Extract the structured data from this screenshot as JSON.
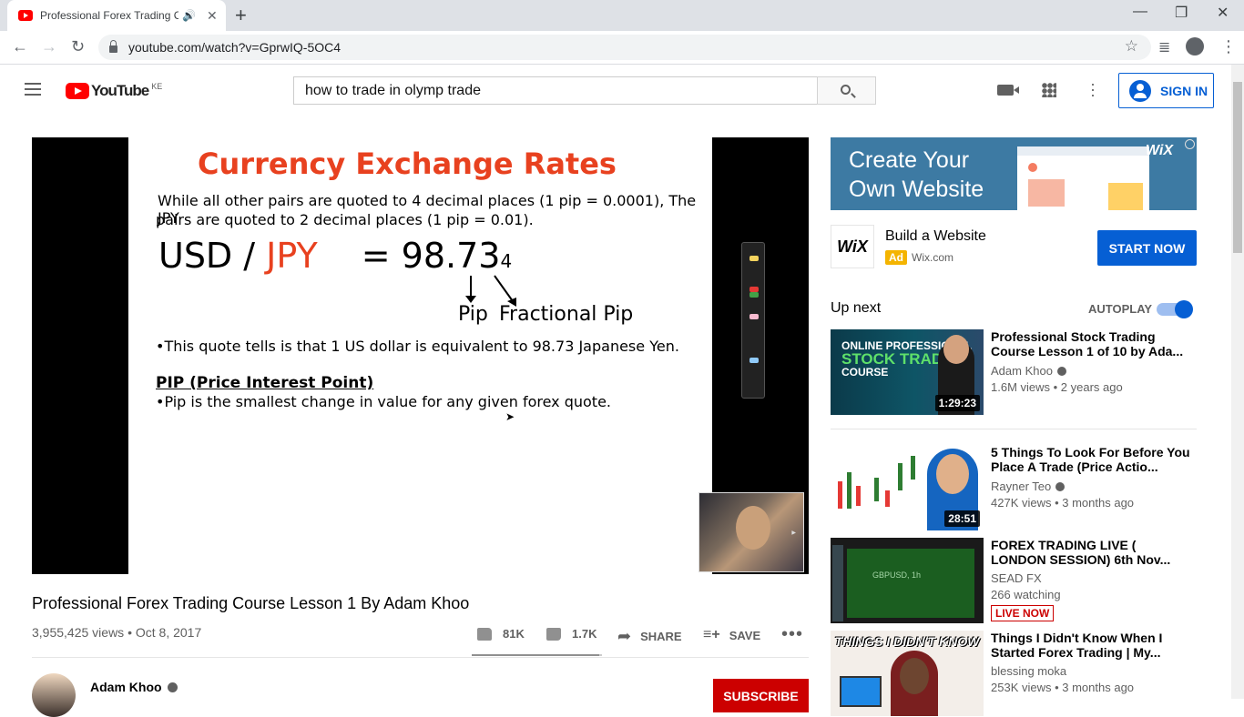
{
  "browser": {
    "tab_title": "Professional Forex Trading C",
    "url": "youtube.com/watch?v=GprwIQ-5OC4"
  },
  "header": {
    "logo_text": "YouTube",
    "country": "KE",
    "search_value": "how to trade in olymp trade",
    "sign_in": "SIGN IN"
  },
  "slide": {
    "title": "Currency Exchange Rates",
    "line1": "While all other pairs are quoted to 4 decimal places  (1 pip = 0.0001), The JPY",
    "line2": "pairs are quoted to 2 decimal places (1 pip = 0.01).",
    "pair_base": "USD /",
    "pair_quote": "JPY",
    "rate_main": "= 98.73",
    "rate_frac": "4",
    "pip_label": "Pip",
    "frac_label": "Fractional Pip",
    "quote_note": "•This quote tells is that 1 US dollar is equivalent to 98.73 Japanese Yen.",
    "pip_heading": "PIP (Price Interest Point)",
    "pip_def": "•Pip is the smallest change in value for any given forex quote."
  },
  "video": {
    "title": "Professional Forex Trading Course Lesson 1 By Adam Khoo",
    "views_date": "3,955,425 views • Oct 8, 2017",
    "likes": "81K",
    "like_ratio": 0.979,
    "dislikes": "1.7K",
    "share": "SHARE",
    "save": "SAVE",
    "channel": "Adam Khoo",
    "subscribe": "SUBSCRIBE"
  },
  "ad": {
    "banner_line1": "Create Your",
    "banner_line2": "Own Website",
    "banner_brand": "WiX",
    "logo_text": "WiX",
    "title": "Build a Website",
    "tag": "Ad",
    "domain": "Wix.com",
    "cta": "START NOW"
  },
  "sidebar": {
    "up_next": "Up next",
    "autoplay": "AUTOPLAY",
    "recs": [
      {
        "title": "Professional Stock Trading Course Lesson 1 of 10 by Ada...",
        "channel": "Adam Khoo",
        "meta": "1.6M views • 2 years ago",
        "duration": "1:29:23",
        "thumb_text1": "ONLINE PROFESSIONAL",
        "thumb_text2": "STOCK TRADING",
        "thumb_text3": "COURSE"
      },
      {
        "title": "5 Things To Look For Before You Place A Trade (Price Actio...",
        "channel": "Rayner Teo",
        "meta": "427K views • 3 months ago",
        "duration": "28:51"
      },
      {
        "title": "FOREX TRADING LIVE ( LONDON SESSION) 6th Nov...",
        "channel": "SEAD FX",
        "meta": "266 watching",
        "live": "LIVE NOW",
        "thumb_text": "GBPUSD, 1h"
      },
      {
        "title": "Things I Didn't Know When I Started Forex Trading | My...",
        "channel": "blessing moka",
        "meta": "253K views • 3 months ago",
        "thumb_text": "THINGS I DIDN'T KNOW"
      }
    ]
  },
  "colors": {
    "yt_red": "#ff0000",
    "slide_red": "#e8411f",
    "blue": "#065fd4"
  }
}
